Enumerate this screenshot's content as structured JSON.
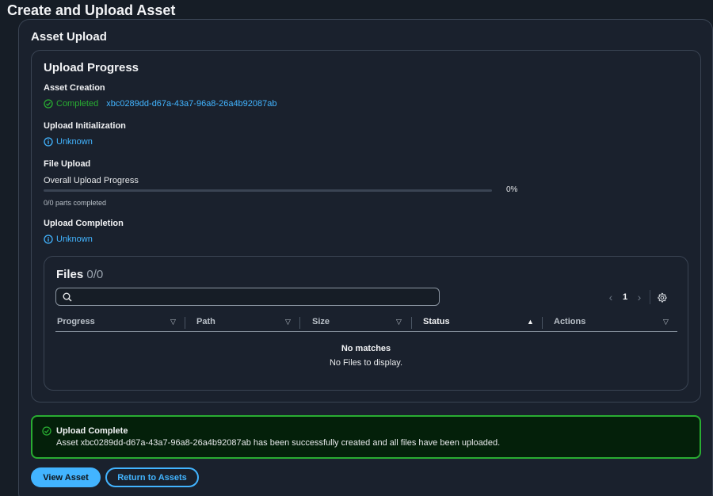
{
  "page": {
    "title": "Create and Upload Asset"
  },
  "asset_upload": {
    "title": "Asset Upload",
    "progress_panel": {
      "title": "Upload Progress",
      "asset_creation": {
        "label": "Asset Creation",
        "status": "Completed",
        "asset_id": "xbc0289dd-d67a-43a7-96a8-26a4b92087ab"
      },
      "upload_initialization": {
        "label": "Upload Initialization",
        "status": "Unknown"
      },
      "file_upload": {
        "label": "File Upload",
        "progress_label": "Overall Upload Progress",
        "progress_value": 0,
        "progress_text": "0%",
        "parts_text": "0/0 parts completed"
      },
      "upload_completion": {
        "label": "Upload Completion",
        "status": "Unknown"
      }
    },
    "files": {
      "title": "Files",
      "count": "0/0",
      "search_value": "",
      "page": "1",
      "columns": [
        {
          "label": "Progress",
          "sort": "none"
        },
        {
          "label": "Path",
          "sort": "none"
        },
        {
          "label": "Size",
          "sort": "none"
        },
        {
          "label": "Status",
          "sort": "ascending"
        },
        {
          "label": "Actions",
          "sort": "none"
        }
      ],
      "empty_title": "No matches",
      "empty_subtitle": "No Files to display."
    },
    "alert": {
      "title": "Upload Complete",
      "message": "Asset xbc0289dd-d67a-43a7-96a8-26a4b92087ab has been successfully created and all files have been uploaded."
    },
    "buttons": {
      "view_asset": "View Asset",
      "return_to_assets": "Return to Assets"
    }
  },
  "colors": {
    "background": "#161d26",
    "accent": "#42b4ff",
    "success": "#29ad32",
    "success_bg": "#04200a",
    "border": "#3a4453"
  },
  "icons": {
    "completed": "check-circle-icon",
    "unknown": "info-circle-icon",
    "search": "search-icon",
    "prev": "chevron-left-icon",
    "next": "chevron-right-icon",
    "settings": "gear-icon",
    "sort_none": "caret-down-icon",
    "sort_ascending": "caret-up-icon"
  }
}
